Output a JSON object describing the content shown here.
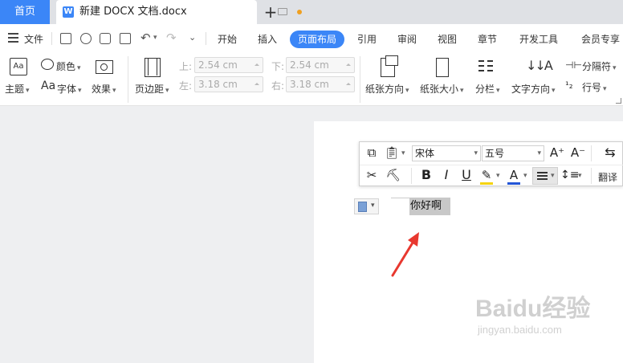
{
  "tabs": {
    "home": "首页",
    "doc_title": "新建 DOCX 文档.docx",
    "new_tab": "+"
  },
  "menubar": {
    "file": "文件",
    "items": [
      "开始",
      "插入",
      "页面布局",
      "引用",
      "审阅",
      "视图",
      "章节",
      "开发工具",
      "会员专享"
    ],
    "active": "页面布局"
  },
  "ribbon": {
    "theme": "主题",
    "color": "颜色",
    "font": "字体",
    "effect": "效果",
    "margins": "页边距",
    "margin_top_label": "上:",
    "margin_top": "2.54 cm",
    "margin_bottom_label": "下:",
    "margin_bottom": "2.54 cm",
    "margin_left_label": "左:",
    "margin_left": "3.18 cm",
    "margin_right_label": "右:",
    "margin_right": "3.18 cm",
    "orientation": "纸张方向",
    "size": "纸张大小",
    "columns": "分栏",
    "text_direction": "文字方向",
    "breaks": "分隔符",
    "line_numbers": "行号"
  },
  "mini_toolbar": {
    "font_name": "宋体",
    "font_size": "五号",
    "translate": "翻译"
  },
  "document": {
    "text": "你好啊"
  },
  "watermark": {
    "brand": "Baidu经验",
    "url": "jingyan.baidu.com"
  },
  "colors": {
    "accent": "#3b86f7",
    "arrow": "#e8382f",
    "highlight": "#f5d312",
    "font_color": "#2456d6"
  }
}
